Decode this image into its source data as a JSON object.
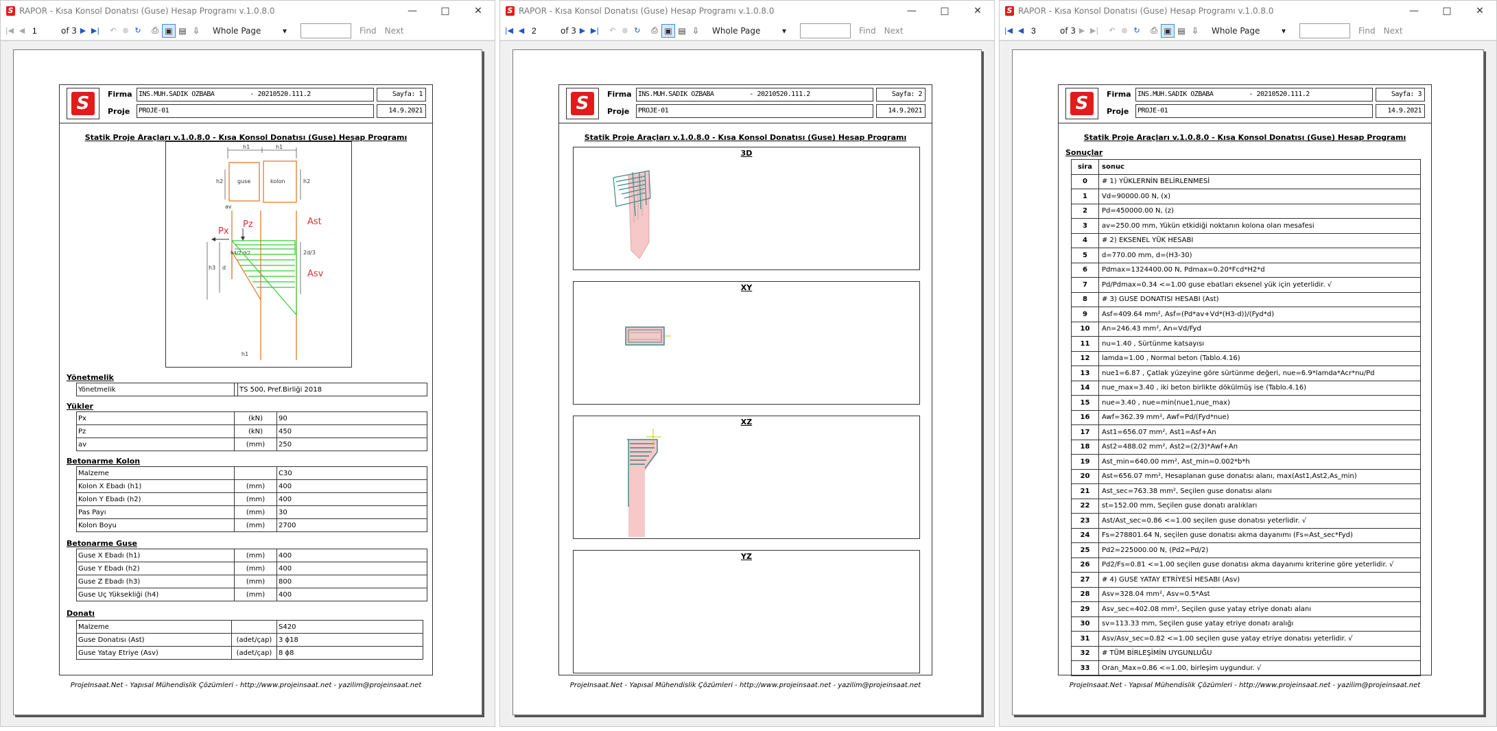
{
  "app_title": "RAPOR - Kısa Konsol Donatısı (Guse) Hesap Programı v.1.0.8.0",
  "toolbar": {
    "of_label": "of 3",
    "zoom": "Whole Page",
    "find": "Find",
    "next": "Next"
  },
  "report_header": {
    "firma_label": "Firma",
    "proje_label": "Proje",
    "firma": "INS.MUH.SADIK OZBABA",
    "firma_code": "- 20210520.111.2",
    "proje": "PROJE-01",
    "date": "14.9.2021"
  },
  "report_title": "Statik Proje Araçları v.1.0.8.0 - Kısa Konsol Donatısı (Guse) Hesap Programı",
  "footer": "ProjeInsaat.Net - Yapısal Mühendislik Çözümleri - http://www.projeinsaat.net - yazilim@projeinsaat.net",
  "windows": [
    {
      "page": "1",
      "sayfa": "Sayfa: 1"
    },
    {
      "page": "2",
      "sayfa": "Sayfa: 2"
    },
    {
      "page": "3",
      "sayfa": "Sayfa: 3"
    }
  ],
  "diagram_labels": {
    "h1": "h1",
    "h2": "h2",
    "h3": "h3",
    "d": "d",
    "av": "av",
    "guse": "guse",
    "kolon": "kolon",
    "px": "Px",
    "pz": "Pz",
    "ast": "Ast",
    "asv": "Asv",
    "h4d2": "h4/2 d/2",
    "twod3": "2d/3"
  },
  "sections": {
    "yonetmelik": {
      "title": "Yönetmelik",
      "rows": [
        [
          "Yönetmelik",
          "",
          "TS 500, Pref.Birliği 2018"
        ]
      ]
    },
    "yukler": {
      "title": "Yükler",
      "rows": [
        [
          "Px",
          "(kN)",
          "90"
        ],
        [
          "Pz",
          "(kN)",
          "450"
        ],
        [
          "av",
          "(mm)",
          "250"
        ]
      ]
    },
    "kolon": {
      "title": "Betonarme Kolon",
      "rows": [
        [
          "Malzeme",
          "",
          "C30"
        ],
        [
          "Kolon X Ebadı (h1)",
          "(mm)",
          "400"
        ],
        [
          "Kolon Y Ebadı (h2)",
          "(mm)",
          "400"
        ],
        [
          "Pas Payı",
          "(mm)",
          "30"
        ],
        [
          "Kolon Boyu",
          "(mm)",
          "2700"
        ]
      ]
    },
    "guse": {
      "title": "Betonarme Guse",
      "rows": [
        [
          "Guse X Ebadı (h1)",
          "(mm)",
          "400"
        ],
        [
          "Guse Y Ebadı (h2)",
          "(mm)",
          "400"
        ],
        [
          "Guse Z Ebadı (h3)",
          "(mm)",
          "800"
        ],
        [
          "Guse Uç Yüksekliği (h4)",
          "(mm)",
          "400"
        ]
      ]
    },
    "donati": {
      "title": "Donatı",
      "rows": [
        [
          "Malzeme",
          "",
          "S420"
        ],
        [
          "Guse Donatısı (Ast)",
          "(adet/çap)",
          "3 ϕ18"
        ],
        [
          "Guse Yatay Etriye (Asv)",
          "(adet/çap)",
          "8 ϕ8"
        ]
      ]
    }
  },
  "views": [
    "3D",
    "XY",
    "XZ",
    "YZ"
  ],
  "results": {
    "title": "Sonuçlar",
    "col_sira": "sira",
    "col_sonuc": "sonuc",
    "rows": [
      [
        "0",
        "# 1) YÜKLERNİN BELİRLENMESİ"
      ],
      [
        "1",
        "Vd=90000.00 N, (x)"
      ],
      [
        "2",
        "Pd=450000.00 N, (z)"
      ],
      [
        "3",
        "av=250.00 mm, Yükün etkidiği noktanın kolona olan mesafesi"
      ],
      [
        "4",
        "# 2) EKSENEL YÜK HESABI"
      ],
      [
        "5",
        "d=770.00 mm, d=(H3-30)"
      ],
      [
        "6",
        "Pdmax=1324400.00 N, Pdmax=0.20*Fcd*H2*d"
      ],
      [
        "7",
        "Pd/Pdmax=0.34 <=1.00 guse ebatları eksenel yük için yeterlidir. √"
      ],
      [
        "8",
        "# 3) GUSE DONATISI HESABI (Ast)"
      ],
      [
        "9",
        "Asf=409.64 mm², Asf=(Pd*av+Vd*(H3-d))/(Fyd*d)"
      ],
      [
        "10",
        "An=246.43 mm², An=Vd/Fyd"
      ],
      [
        "11",
        "nu=1.40 , Sürtünme katsayısı"
      ],
      [
        "12",
        "lamda=1.00 , Normal beton (Tablo.4.16)"
      ],
      [
        "13",
        "nue1=6.87 , Çatlak yüzeyine göre sürtünme değeri, nue=6.9*lamda*Acr*nu/Pd"
      ],
      [
        "14",
        "nue_max=3.40 , iki beton birlikte dökülmüş ise (Tablo.4.16)"
      ],
      [
        "15",
        "nue=3.40 , nue=min(nue1,nue_max)"
      ],
      [
        "16",
        "Awf=362.39 mm², Awf=Pd/(Fyd*nue)"
      ],
      [
        "17",
        "Ast1=656.07 mm², Ast1=Asf+An"
      ],
      [
        "18",
        "Ast2=488.02 mm², Ast2=(2/3)*Awf+An"
      ],
      [
        "19",
        "Ast_min=640.00 mm², Ast_min=0.002*b*h"
      ],
      [
        "20",
        "Ast=656.07 mm², Hesaplanan guse donatısı alanı, max(Ast1,Ast2,As_min)"
      ],
      [
        "21",
        "Ast_sec=763.38 mm², Seçilen guse donatısı alanı"
      ],
      [
        "22",
        "st=152.00 mm, Seçilen guse donatı aralıkları"
      ],
      [
        "23",
        "Ast/Ast_sec=0.86 <=1.00 seçilen guse donatısı yeterlidir. √"
      ],
      [
        "24",
        "Fs=278801.64 N, seçilen guse donatısı akma dayanımı (Fs=Ast_sec*Fyd)"
      ],
      [
        "25",
        "Pd2=225000.00 N, (Pd2=Pd/2)"
      ],
      [
        "26",
        "Pd2/Fs=0.81 <=1.00 seçilen guse donatısı akma dayanımı kriterine göre yeterlidir. √"
      ],
      [
        "27",
        "# 4) GUSE YATAY ETRİYESİ HESABI (Asv)"
      ],
      [
        "28",
        "Asv=328.04 mm², Asv=0.5*Ast"
      ],
      [
        "29",
        "Asv_sec=402.08 mm², Seçilen guse yatay etriye donatı alanı"
      ],
      [
        "30",
        "sv=113.33 mm, Seçilen guse yatay etriye donatı aralığı"
      ],
      [
        "31",
        "Asv/Asv_sec=0.82 <=1.00 seçilen guse yatay etriye donatısı yeterlidir. √"
      ],
      [
        "32",
        "# TÜM BİRLEŞİMİN UYGUNLUĞU"
      ],
      [
        "33",
        "Oran_Max=0.86 <=1.00, birleşim uygundur. √"
      ]
    ]
  }
}
